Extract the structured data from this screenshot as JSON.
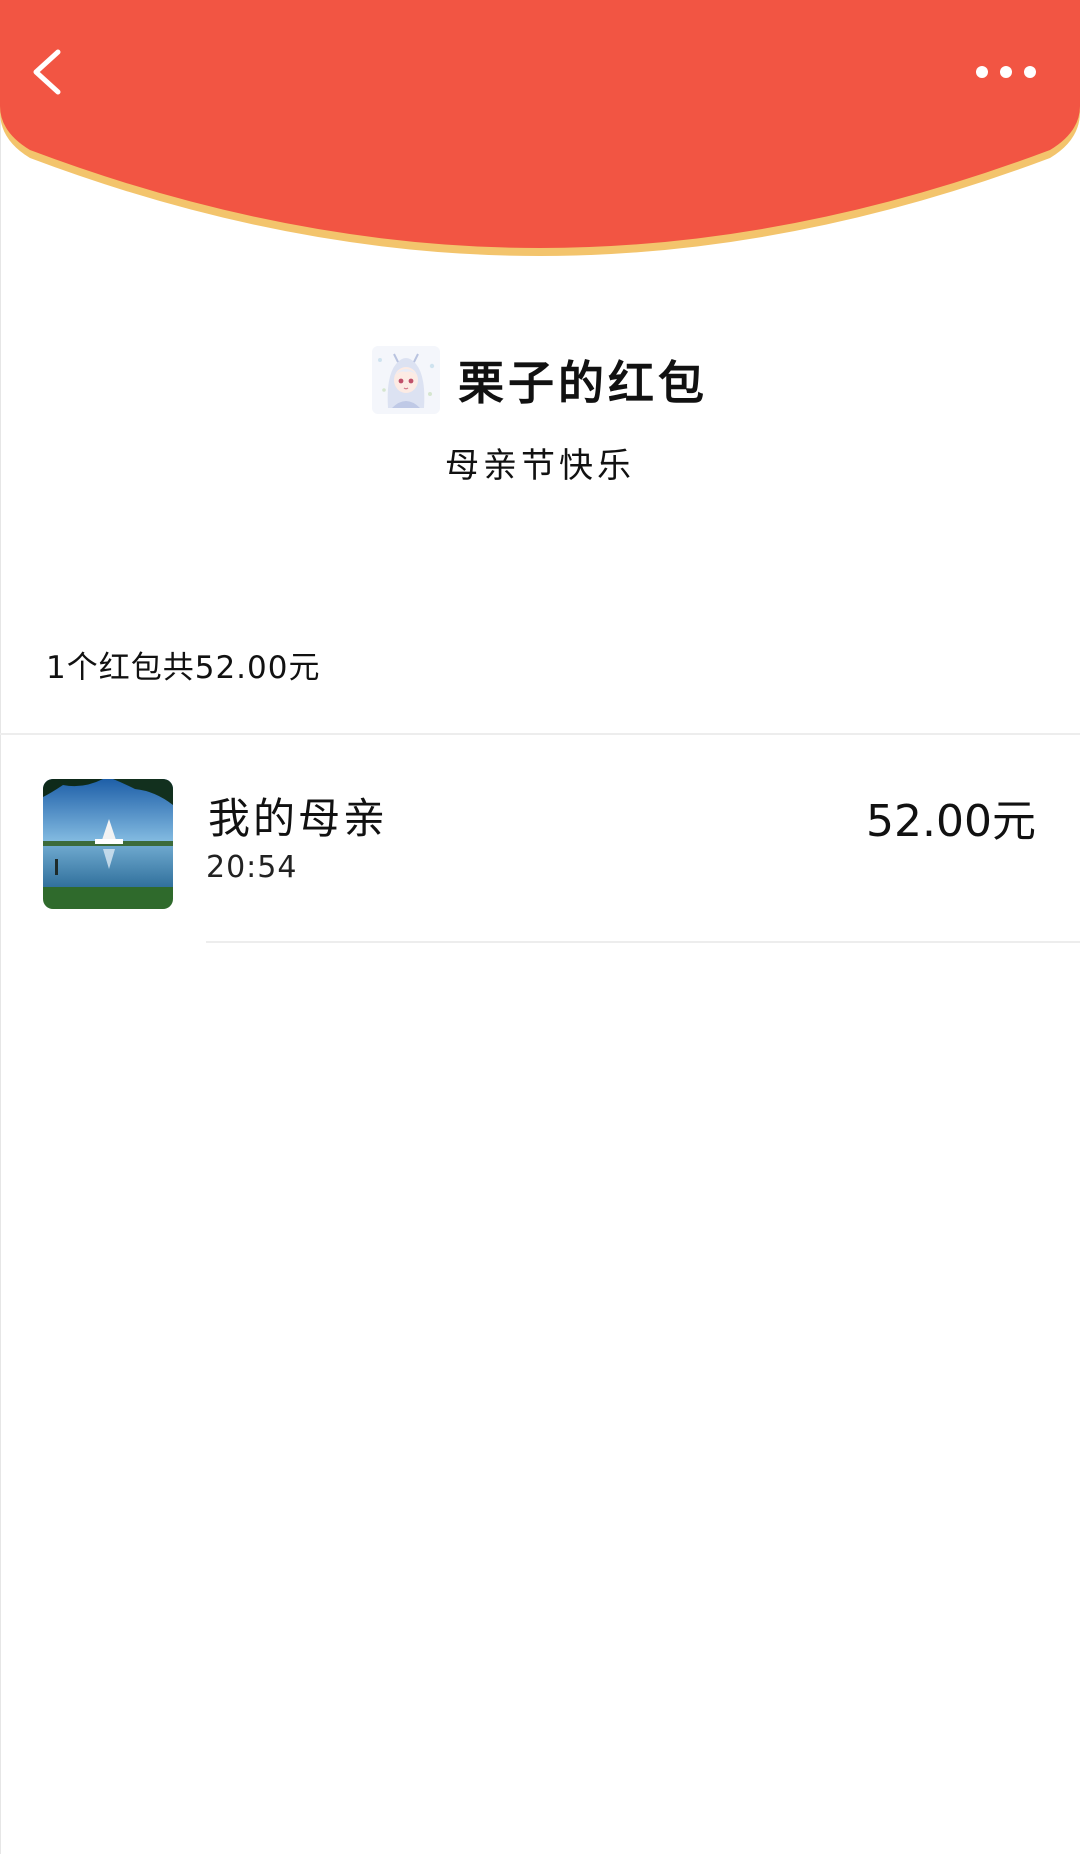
{
  "colors": {
    "header_red": "#F25543",
    "header_trim": "#F3C46C",
    "divider": "#EDEDED",
    "text_primary": "#111111"
  },
  "header": {
    "back_icon": "back-chevron-icon",
    "more_icon": "more-dots-icon"
  },
  "sender": {
    "avatar": "anime-girl-avatar",
    "title": "栗子的红包",
    "greeting": "母亲节快乐"
  },
  "summary": {
    "text": "1个红包共52.00元"
  },
  "claims": [
    {
      "avatar": "lake-temple-photo-avatar",
      "name": "我的母亲",
      "time": "20:54",
      "amount": "52.00元"
    }
  ]
}
